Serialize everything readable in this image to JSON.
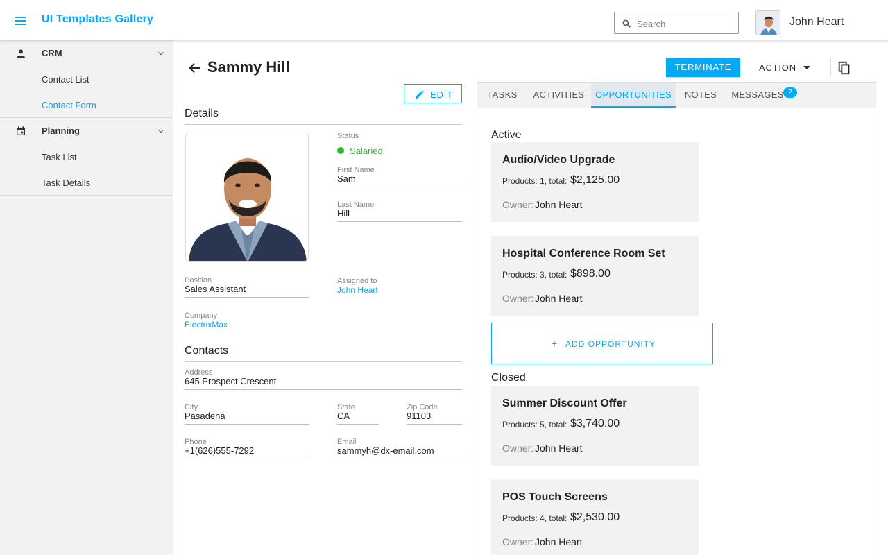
{
  "header": {
    "app_title": "UI Templates Gallery",
    "search_placeholder": "Search",
    "user_name": "John Heart"
  },
  "sidebar": {
    "groups": [
      {
        "label": "CRM",
        "icon": "person-icon",
        "items": [
          "Contact List",
          "Contact Form"
        ],
        "active_item": "Contact Form"
      },
      {
        "label": "Planning",
        "icon": "calendar-icon",
        "items": [
          "Task List",
          "Task Details"
        ]
      }
    ]
  },
  "toolbar": {
    "title": "Sammy Hill",
    "terminate_label": "TERMINATE",
    "action_label": "ACTION"
  },
  "details": {
    "edit_label": "EDIT",
    "section_title": "Details",
    "status_label": "Status",
    "status_value": "Salaried",
    "first_name_label": "First Name",
    "first_name": "Sam",
    "last_name_label": "Last Name",
    "last_name": "Hill",
    "position_label": "Position",
    "position": "Sales Assistant",
    "assigned_label": "Assigned to",
    "assigned": "John Heart",
    "company_label": "Company",
    "company": "ElectrixMax"
  },
  "contacts": {
    "section_title": "Contacts",
    "address_label": "Address",
    "address": "645 Prospect Crescent",
    "city_label": "City",
    "city": "Pasadena",
    "state_label": "State",
    "state": "CA",
    "zip_label": "Zip Code",
    "zip": "91103",
    "phone_label": "Phone",
    "phone": "+1(626)555-7292",
    "email_label": "Email",
    "email": "sammyh@dx-email.com"
  },
  "tabs": {
    "items": [
      "TASKS",
      "ACTIVITIES",
      "OPPORTUNITIES",
      "NOTES",
      "MESSAGES"
    ],
    "active": "OPPORTUNITIES",
    "messages_badge": "2"
  },
  "opportunities": {
    "active_title": "Active",
    "closed_title": "Closed",
    "add_label": "ADD OPPORTUNITY",
    "add_icon": "+",
    "owner_label": "Owner:",
    "active": [
      {
        "name": "Audio/Video Upgrade",
        "products_text": "Products: 1, total:",
        "total": "$2,125.00",
        "owner": "John Heart"
      },
      {
        "name": "Hospital Conference Room Set",
        "products_text": "Products: 3, total:",
        "total": "$898.00",
        "owner": "John Heart"
      }
    ],
    "closed": [
      {
        "name": "Summer Discount Offer",
        "products_text": "Products: 5, total:",
        "total": "$3,740.00",
        "owner": "John Heart"
      },
      {
        "name": "POS Touch Screens",
        "products_text": "Products: 4, total:",
        "total": "$2,530.00",
        "owner": "John Heart"
      }
    ]
  },
  "colors": {
    "accent": "#03a9f4",
    "status_green": "#2eb82e",
    "sidebar_bg": "#f2f2f2",
    "card_bg": "#f2f2f2"
  },
  "icons": [
    "menu-icon",
    "search-icon",
    "person-icon",
    "calendar-icon",
    "chevron-down-icon",
    "arrow-back-icon",
    "copy-icon",
    "pencil-icon",
    "caret-down-icon"
  ]
}
